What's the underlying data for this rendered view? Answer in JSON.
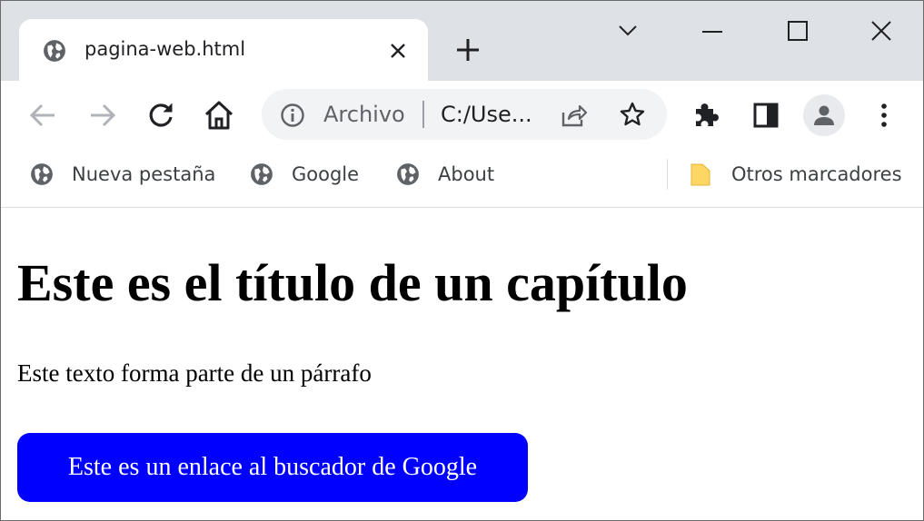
{
  "tab": {
    "title": "pagina-web.html"
  },
  "omnibox": {
    "scheme_label": "Archivo",
    "url": "C:/Use..."
  },
  "bookmarks": {
    "items": [
      {
        "label": "Nueva pestaña"
      },
      {
        "label": "Google"
      },
      {
        "label": "About"
      }
    ],
    "other_label": "Otros marcadores"
  },
  "page": {
    "heading": "Este es el título de un capítulo",
    "paragraph": "Este texto forma parte de un párrafo",
    "link_label": "Este es un enlace al buscador de Google"
  },
  "colors": {
    "tabstrip": "#dee1e6",
    "link_button": "#0000ff",
    "folder": "#fdd663"
  },
  "icons": {
    "favicon": "globe-icon",
    "close": "close-icon",
    "new_tab": "plus-icon",
    "back": "arrow-left-icon",
    "forward": "arrow-right-icon",
    "reload": "reload-icon",
    "home": "home-icon",
    "info": "info-icon",
    "share": "share-icon",
    "star": "star-icon",
    "extensions": "puzzle-icon",
    "side_panel": "side-panel-icon",
    "profile": "person-icon",
    "menu": "kebab-menu-icon",
    "folder": "folder-icon"
  }
}
